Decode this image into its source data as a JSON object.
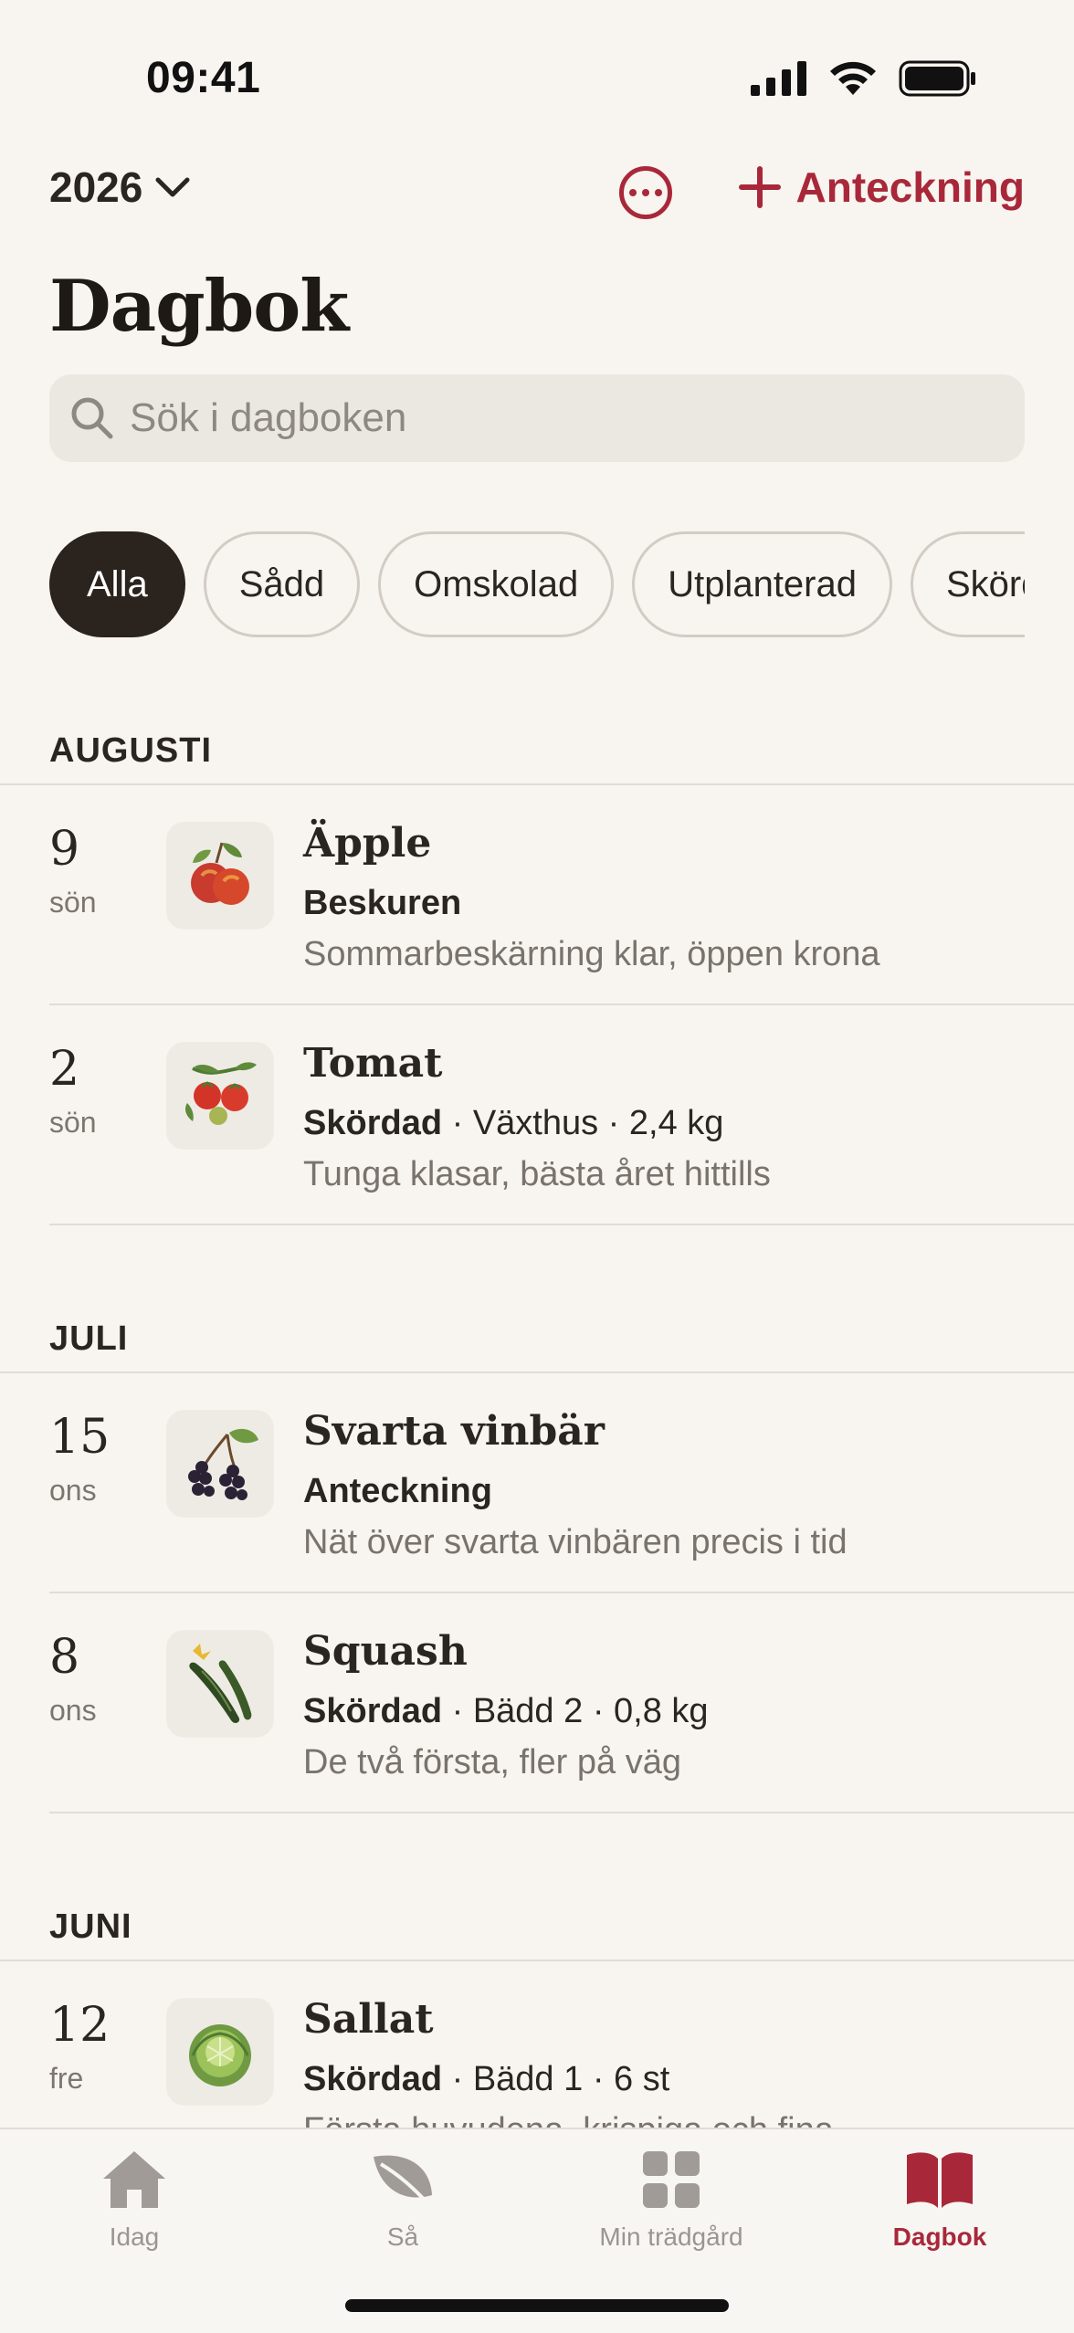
{
  "status_bar": {
    "time": "09:41"
  },
  "header": {
    "year": "2026",
    "add_note_label": "Anteckning",
    "title": "Dagbok"
  },
  "search": {
    "placeholder": "Sök i dagboken"
  },
  "filters": [
    "Alla",
    "Sådd",
    "Omskolad",
    "Utplanterad",
    "Skördad"
  ],
  "active_filter": "Alla",
  "months": [
    {
      "name": "AUGUSTI",
      "entries": [
        {
          "day": "9",
          "weekday": "sön",
          "plant": "Äpple",
          "status": "Beskuren",
          "details": "",
          "note": "Sommarbeskärning klar, öppen krona",
          "icon": "apple-icon"
        },
        {
          "day": "2",
          "weekday": "sön",
          "plant": "Tomat",
          "status": "Skördad",
          "details": " · Växthus · 2,4 kg",
          "note": "Tunga klasar, bästa året hittills",
          "icon": "tomato-icon"
        }
      ]
    },
    {
      "name": "JULI",
      "entries": [
        {
          "day": "15",
          "weekday": "ons",
          "plant": "Svarta vinbär",
          "status": "Anteckning",
          "details": "",
          "note": "Nät över svarta vinbären precis i tid",
          "icon": "blackcurrant-icon"
        },
        {
          "day": "8",
          "weekday": "ons",
          "plant": "Squash",
          "status": "Skördad",
          "details": " · Bädd 2 · 0,8 kg",
          "note": "De två första, fler på väg",
          "icon": "zucchini-icon"
        }
      ]
    },
    {
      "name": "JUNI",
      "entries": [
        {
          "day": "12",
          "weekday": "fre",
          "plant": "Sallat",
          "status": "Skördad",
          "details": " · Bädd 1 · 6 st",
          "note": "Första huvudena, krispiga och fina",
          "icon": "lettuce-icon"
        }
      ]
    }
  ],
  "tabs": [
    {
      "label": "Idag",
      "icon": "house-icon"
    },
    {
      "label": "Så",
      "icon": "leaf-icon"
    },
    {
      "label": "Min trädgård",
      "icon": "grid-icon"
    },
    {
      "label": "Dagbok",
      "icon": "book-icon"
    }
  ],
  "active_tab": "Dagbok",
  "colors": {
    "accent": "#a8283a",
    "background": "#f8f4ef",
    "chip_active": "#2a231e"
  }
}
